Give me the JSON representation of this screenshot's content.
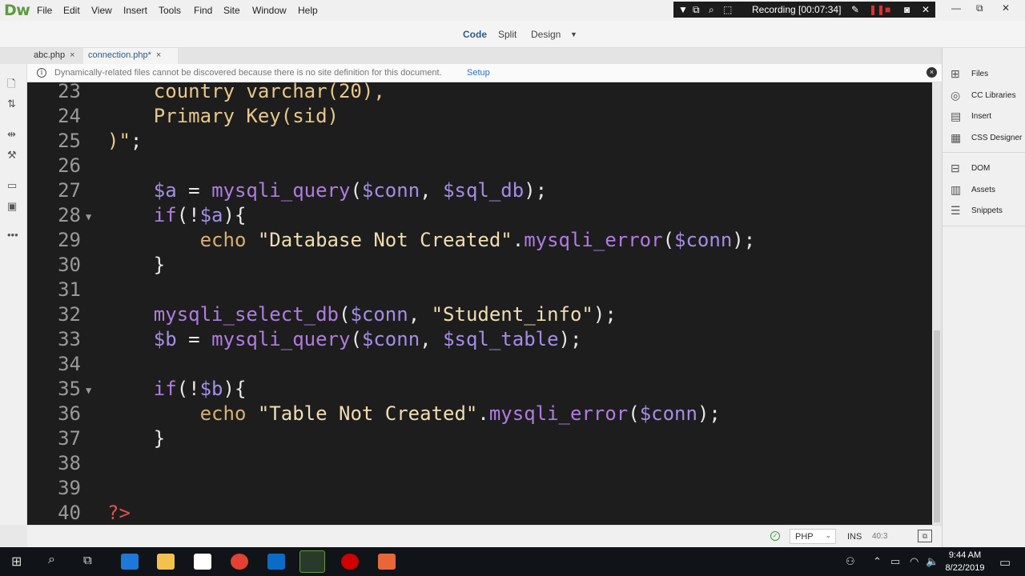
{
  "app": {
    "logo": "Dw"
  },
  "menu": [
    "File",
    "Edit",
    "View",
    "Insert",
    "Tools",
    "Find",
    "Site",
    "Window",
    "Help"
  ],
  "recording": {
    "label": "Recording [00:07:34]"
  },
  "view_modes": {
    "code": "Code",
    "split": "Split",
    "design": "Design"
  },
  "tabs": [
    {
      "label": "abc.php",
      "close": "×"
    },
    {
      "label": "connection.php*",
      "close": "×"
    }
  ],
  "infobar": {
    "message": "Dynamically-related files cannot be discovered because there is no site definition for this document.",
    "link": "Setup",
    "info_glyph": "i",
    "close_glyph": "×"
  },
  "code": {
    "lines": [
      {
        "n": "23",
        "fold": "",
        "parts": [
          [
            "old",
            "    country varchar(20),"
          ]
        ]
      },
      {
        "n": "24",
        "fold": "",
        "parts": [
          [
            "old",
            "    Primary Key(sid)"
          ]
        ]
      },
      {
        "n": "25",
        "fold": "",
        "parts": [
          [
            "old",
            ")\""
          ],
          [
            "plain",
            ";"
          ]
        ]
      },
      {
        "n": "26",
        "fold": "",
        "parts": []
      },
      {
        "n": "27",
        "fold": "",
        "parts": [
          [
            "var",
            "$a"
          ],
          [
            "plain",
            " = "
          ],
          [
            "fn",
            "mysqli_query"
          ],
          [
            "plain",
            "("
          ],
          [
            "var",
            "$conn"
          ],
          [
            "plain",
            ", "
          ],
          [
            "var",
            "$sql_db"
          ],
          [
            "plain",
            ");"
          ]
        ]
      },
      {
        "n": "28",
        "fold": "▼",
        "parts": [
          [
            "key",
            "if"
          ],
          [
            "plain",
            "(!"
          ],
          [
            "var",
            "$a"
          ],
          [
            "plain",
            "){"
          ]
        ]
      },
      {
        "n": "29",
        "fold": "",
        "parts": [
          [
            "plain",
            "    "
          ],
          [
            "echo",
            "echo"
          ],
          [
            "plain",
            " "
          ],
          [
            "str",
            "\"Database Not Created\""
          ],
          [
            "plain",
            "."
          ],
          [
            "fn",
            "mysqli_error"
          ],
          [
            "plain",
            "("
          ],
          [
            "var",
            "$conn"
          ],
          [
            "plain",
            ");"
          ]
        ]
      },
      {
        "n": "30",
        "fold": "",
        "parts": [
          [
            "plain",
            "}"
          ]
        ]
      },
      {
        "n": "31",
        "fold": "",
        "parts": []
      },
      {
        "n": "32",
        "fold": "",
        "parts": [
          [
            "fn",
            "mysqli_select_db"
          ],
          [
            "plain",
            "("
          ],
          [
            "var",
            "$conn"
          ],
          [
            "plain",
            ", "
          ],
          [
            "str",
            "\"Student_info\""
          ],
          [
            "plain",
            ");"
          ]
        ]
      },
      {
        "n": "33",
        "fold": "",
        "parts": [
          [
            "var",
            "$b"
          ],
          [
            "plain",
            " = "
          ],
          [
            "fn",
            "mysqli_query"
          ],
          [
            "plain",
            "("
          ],
          [
            "var",
            "$conn"
          ],
          [
            "plain",
            ", "
          ],
          [
            "var",
            "$sql_table"
          ],
          [
            "plain",
            ");"
          ]
        ]
      },
      {
        "n": "34",
        "fold": "",
        "parts": []
      },
      {
        "n": "35",
        "fold": "▼",
        "parts": [
          [
            "key",
            "if"
          ],
          [
            "plain",
            "(!"
          ],
          [
            "var",
            "$b"
          ],
          [
            "plain",
            "){"
          ]
        ]
      },
      {
        "n": "36",
        "fold": "",
        "parts": [
          [
            "plain",
            "    "
          ],
          [
            "echo",
            "echo"
          ],
          [
            "plain",
            " "
          ],
          [
            "str",
            "\"Table Not Created\""
          ],
          [
            "plain",
            "."
          ],
          [
            "fn",
            "mysqli_error"
          ],
          [
            "plain",
            "("
          ],
          [
            "var",
            "$conn"
          ],
          [
            "plain",
            ");"
          ]
        ]
      },
      {
        "n": "37",
        "fold": "",
        "parts": [
          [
            "plain",
            "}"
          ]
        ]
      },
      {
        "n": "38",
        "fold": "",
        "parts": []
      },
      {
        "n": "39",
        "fold": "",
        "parts": []
      },
      {
        "n": "40",
        "fold": "",
        "parts": [
          [
            "tag",
            "?>"
          ]
        ]
      }
    ]
  },
  "status": {
    "language": "PHP",
    "mode": "INS",
    "position": "40:3"
  },
  "right_panel": {
    "items": [
      "Files",
      "CC Libraries",
      "Insert",
      "CSS Designer",
      "DOM",
      "Assets",
      "Snippets"
    ]
  },
  "taskbar": {
    "time": "9:44 AM",
    "date": "8/22/2019"
  },
  "colors": {
    "editor_bg": "#1d1d1d",
    "dw_green": "#5d9c3e",
    "link": "#2a72c4"
  }
}
